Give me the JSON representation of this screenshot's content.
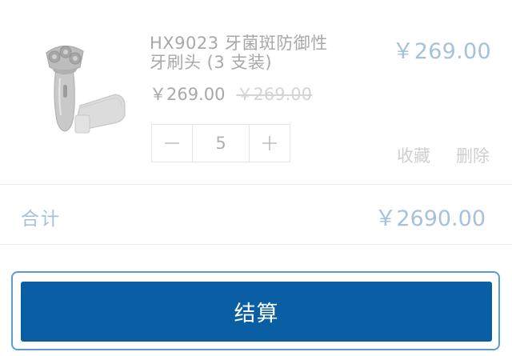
{
  "cart_item": {
    "title": "HX9023 牙菌斑防御性牙刷头 (3 支装)",
    "line_total": "￥269.00",
    "price": "￥269.00",
    "original_price": "￥269.00",
    "quantity": "5",
    "favorite_label": "收藏",
    "delete_label": "删除",
    "image_icon": "electric-shaver-product-image"
  },
  "summary": {
    "total_label": "合计",
    "total_value": "￥2690.00"
  },
  "checkout": {
    "button_label": "结算"
  },
  "colors": {
    "accent_light": "#a5c2da",
    "button_bg": "#0a5fa4",
    "focus_ring": "#5b9bd5",
    "muted_text": "#a8a8a8"
  }
}
